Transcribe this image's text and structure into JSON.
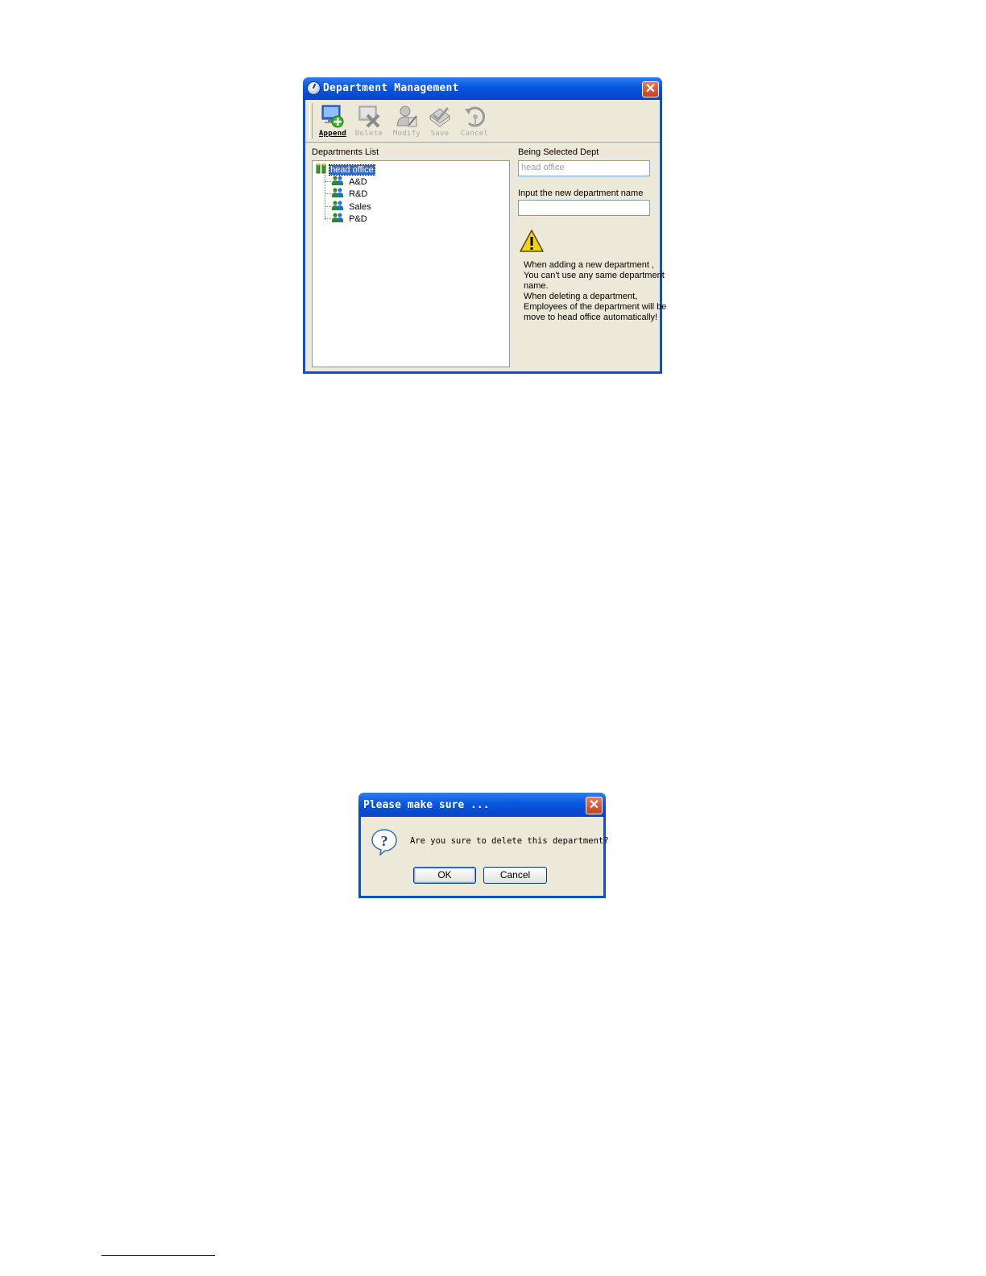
{
  "window": {
    "title": "Department Management",
    "close_glyph": "✕",
    "toolbar": [
      {
        "label": "Append",
        "icon": "append-icon",
        "enabled": true
      },
      {
        "label": "Delete",
        "icon": "delete-icon",
        "enabled": false
      },
      {
        "label": "Modify",
        "icon": "modify-icon",
        "enabled": false
      },
      {
        "label": "Save",
        "icon": "save-icon",
        "enabled": false
      },
      {
        "label": "Cancel",
        "icon": "cancel-icon",
        "enabled": false
      }
    ],
    "departments_list_label": "Departments List",
    "tree": {
      "root": "head office",
      "children": [
        "A&D",
        "R&D",
        "Sales",
        "P&D"
      ]
    },
    "being_selected_label": "Being Selected Dept",
    "being_selected_value": "head office",
    "new_name_label": "Input the new department name",
    "new_name_value": "",
    "warning_lines": [
      "When adding a new department ,",
      "You can't use any same department",
      "name.",
      "When deleting a department,",
      "Employees of the department will be",
      "move to head office automatically!"
    ]
  },
  "dialog": {
    "title": "Please make sure ...",
    "close_glyph": "✕",
    "message": "Are you sure to delete this department?",
    "ok_label": "OK",
    "cancel_label": "Cancel"
  },
  "colors": {
    "title_bar": "#0856e0",
    "client_bg": "#ece9d8",
    "selection": "#316ac5",
    "close_button": "#c8401d"
  }
}
